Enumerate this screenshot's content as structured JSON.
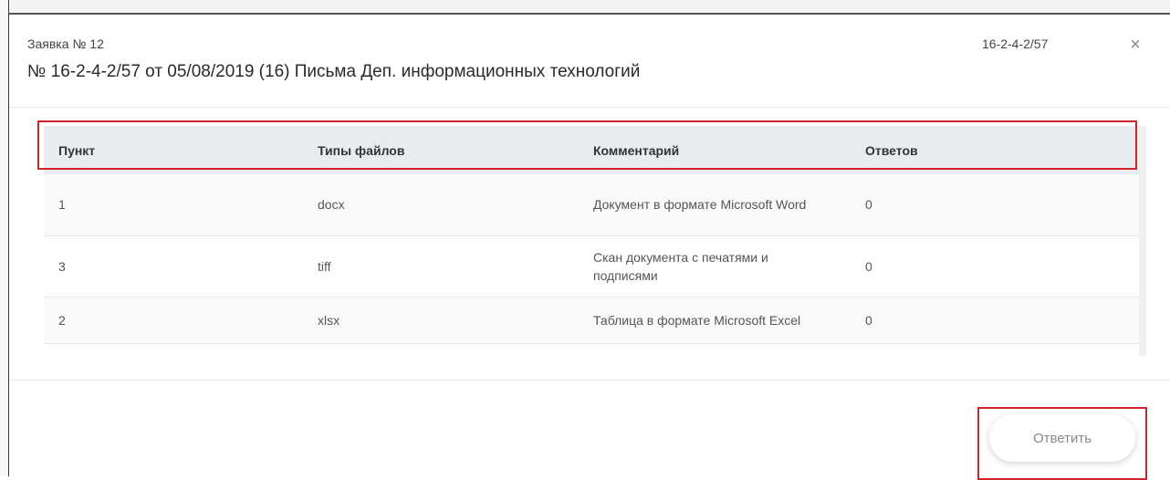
{
  "modal": {
    "request_number": "Заявка  № 12",
    "code": "16-2-4-2/57",
    "close_symbol": "×",
    "title": "№ 16-2-4-2/57 от 05/08/2019 (16) Письма Деп. информационных технологий"
  },
  "table": {
    "columns": [
      "Пункт",
      "Типы файлов",
      "Комментарий",
      "Ответов"
    ],
    "rows": [
      {
        "item": "1",
        "file_type": "docx",
        "comment": "Документ в формате Microsoft Word",
        "answers": "0"
      },
      {
        "item": "3",
        "file_type": "tiff",
        "comment": "Скан документа с печатями и подписями",
        "answers": "0"
      },
      {
        "item": "2",
        "file_type": "xlsx",
        "comment": "Таблица в формате Microsoft Excel",
        "answers": "0"
      }
    ]
  },
  "actions": {
    "reply_label": "Ответить"
  },
  "colors": {
    "highlight": "#d2232a",
    "header_bg": "#e8ecef"
  }
}
